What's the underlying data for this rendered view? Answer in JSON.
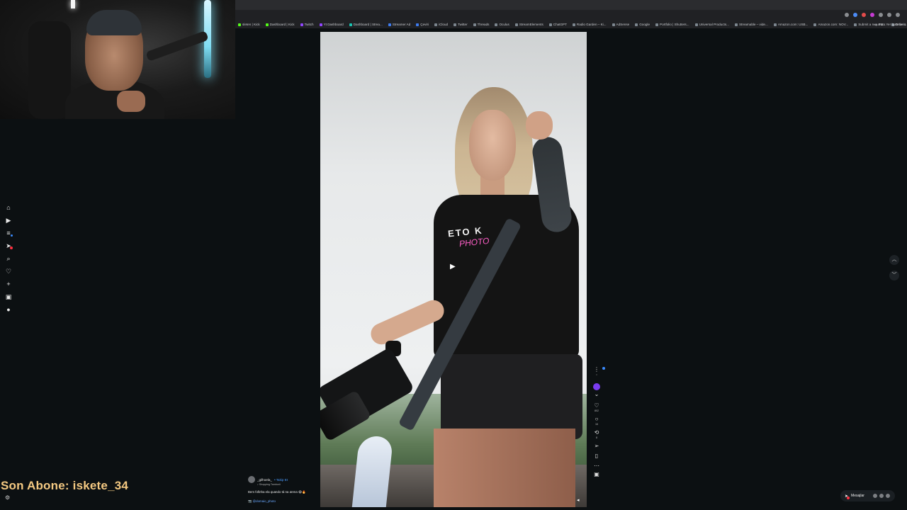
{
  "overlay": {
    "last_subscriber": "Son Abone: iskete_34"
  },
  "bookmarks": [
    {
      "label": "sleten | Kick",
      "color": "green"
    },
    {
      "label": "Dashboard | Kick",
      "color": "green"
    },
    {
      "label": "Twitch",
      "color": "purple"
    },
    {
      "label": "Yt Dashboard",
      "color": "purple"
    },
    {
      "label": "Dashboard | Strea...",
      "color": "teal"
    },
    {
      "label": "Streamer Ad",
      "color": "blue"
    },
    {
      "label": "Çeviri",
      "color": "blue"
    },
    {
      "label": "iCloud",
      "color": ""
    },
    {
      "label": "Twitter",
      "color": ""
    },
    {
      "label": "Threads",
      "color": ""
    },
    {
      "label": "Oculus",
      "color": ""
    },
    {
      "label": "StreamElements",
      "color": ""
    },
    {
      "label": "ChatGPT",
      "color": ""
    },
    {
      "label": "Radio Garden – Ki...",
      "color": ""
    },
    {
      "label": "AdSense",
      "color": ""
    },
    {
      "label": "Google",
      "color": ""
    },
    {
      "label": "Portfolio | Shutters...",
      "color": ""
    },
    {
      "label": "Universal Products...",
      "color": ""
    },
    {
      "label": "Streamable – vide...",
      "color": ""
    },
    {
      "label": "Amazon.com: USB...",
      "color": ""
    },
    {
      "label": "Amazon.com: NOV...",
      "color": ""
    },
    {
      "label": "Submit a request...",
      "color": ""
    },
    {
      "label": "Drive & Listen",
      "color": ""
    }
  ],
  "bookmarks_all": "Tüm Yer İşaretleri",
  "sidebar": [
    {
      "name": "home-icon",
      "glyph": "⌂"
    },
    {
      "name": "reels-icon",
      "glyph": "▶"
    },
    {
      "name": "feed-icon",
      "glyph": "≡"
    },
    {
      "name": "direct-icon",
      "glyph": "➤"
    },
    {
      "name": "search-icon",
      "glyph": "⌕"
    },
    {
      "name": "notifications-icon",
      "glyph": "♡"
    },
    {
      "name": "create-icon",
      "glyph": "+"
    },
    {
      "name": "dashboard-icon",
      "glyph": "▣"
    },
    {
      "name": "profile-icon",
      "glyph": "●"
    }
  ],
  "reel": {
    "shirt_text_1": "ETO K",
    "shirt_text_2": "PHOTO"
  },
  "actions": {
    "like_count": "802",
    "comment_count": "16",
    "repost_count": "8"
  },
  "caption": {
    "username": "_gilhoela_",
    "follow": "• Takip Et",
    "shopping": "♪ Shopping Tamborii",
    "text": "Bem fofinha ela quando tá na arena 😂🔥",
    "tag": "📷 @domaio_photo"
  },
  "messages": {
    "label": "Mesajlar"
  }
}
